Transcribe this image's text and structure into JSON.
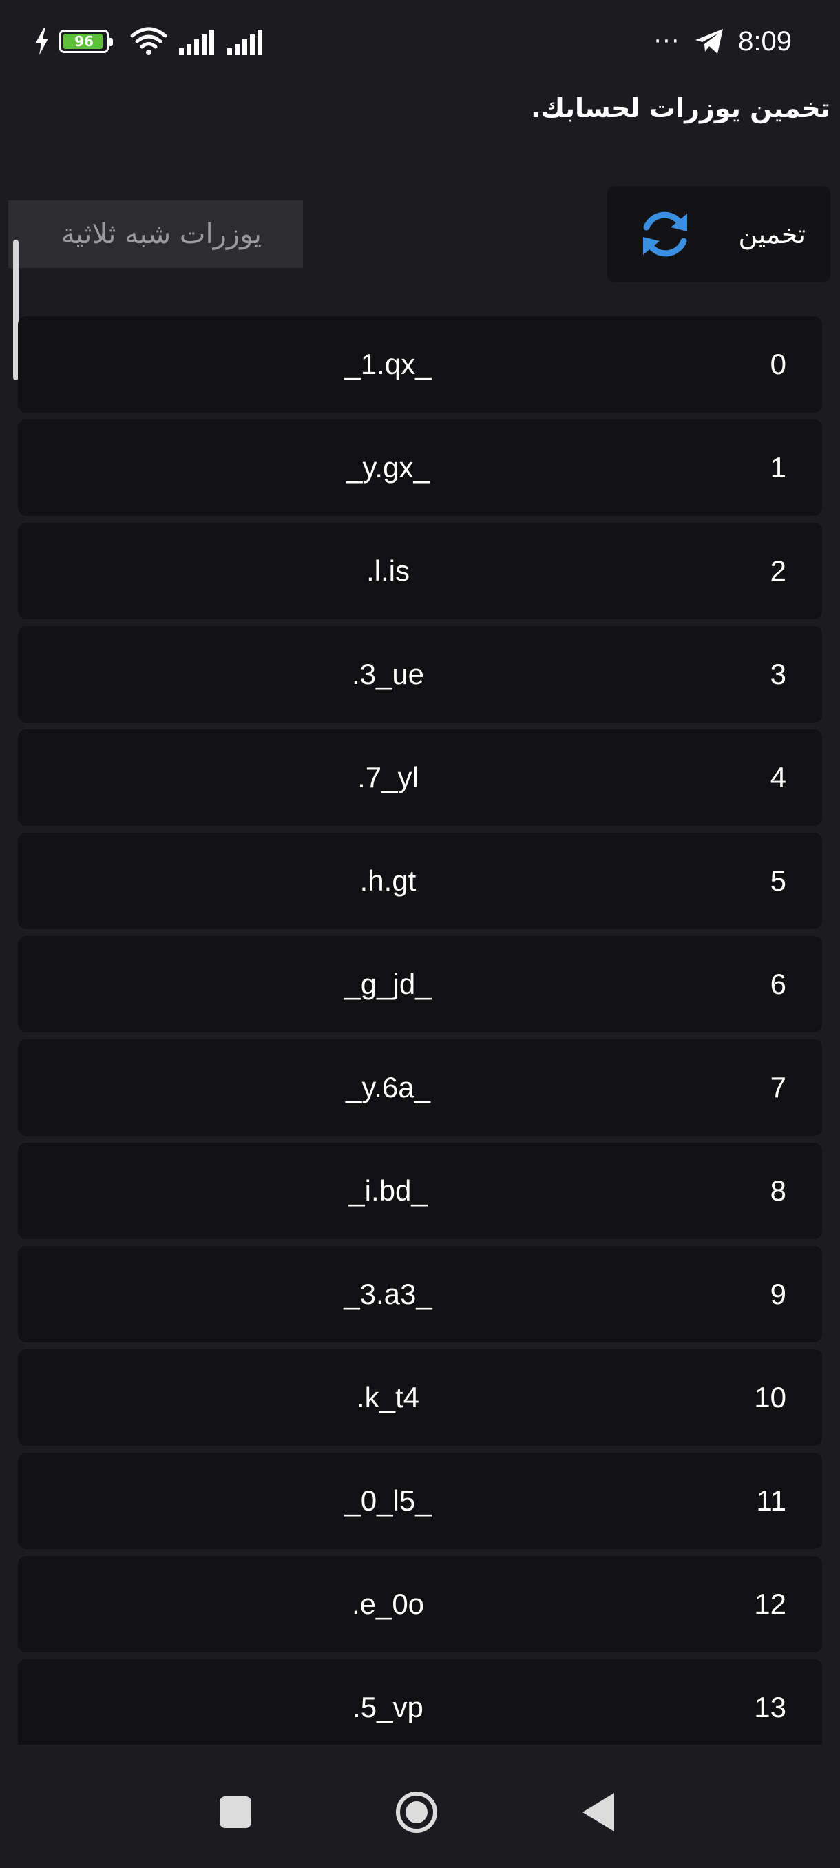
{
  "status_bar": {
    "battery_level": "96",
    "overflow": "···",
    "time": "8:09"
  },
  "header": {
    "title": "تخمين يوزرات لحسابك."
  },
  "toolbar": {
    "guess_label": "تخمين",
    "type_value": "يوزرات شبه ثلاثية"
  },
  "usernames": [
    {
      "index": "0",
      "name": "_1.qx_"
    },
    {
      "index": "1",
      "name": "_y.gx_"
    },
    {
      "index": "2",
      "name": ".l.is"
    },
    {
      "index": "3",
      "name": ".3_ue"
    },
    {
      "index": "4",
      "name": ".7_yl"
    },
    {
      "index": "5",
      "name": ".h.gt"
    },
    {
      "index": "6",
      "name": "_g_jd_"
    },
    {
      "index": "7",
      "name": "_y.6a_"
    },
    {
      "index": "8",
      "name": "_i.bd_"
    },
    {
      "index": "9",
      "name": "_3.a3_"
    },
    {
      "index": "10",
      "name": ".k_t4"
    },
    {
      "index": "11",
      "name": "_0_l5_"
    },
    {
      "index": "12",
      "name": ".e_0o"
    },
    {
      "index": "13",
      "name": ".5_vp"
    }
  ],
  "colors": {
    "background": "#1b1b20",
    "row_background": "#111113",
    "accent": "#3a8fe0",
    "battery": "#5fbf3b"
  },
  "icons": {
    "guess": "refresh-icon",
    "charging": "bolt-icon",
    "wifi": "wifi-icon",
    "signal": "signal-icon",
    "telegram": "telegram-icon"
  }
}
